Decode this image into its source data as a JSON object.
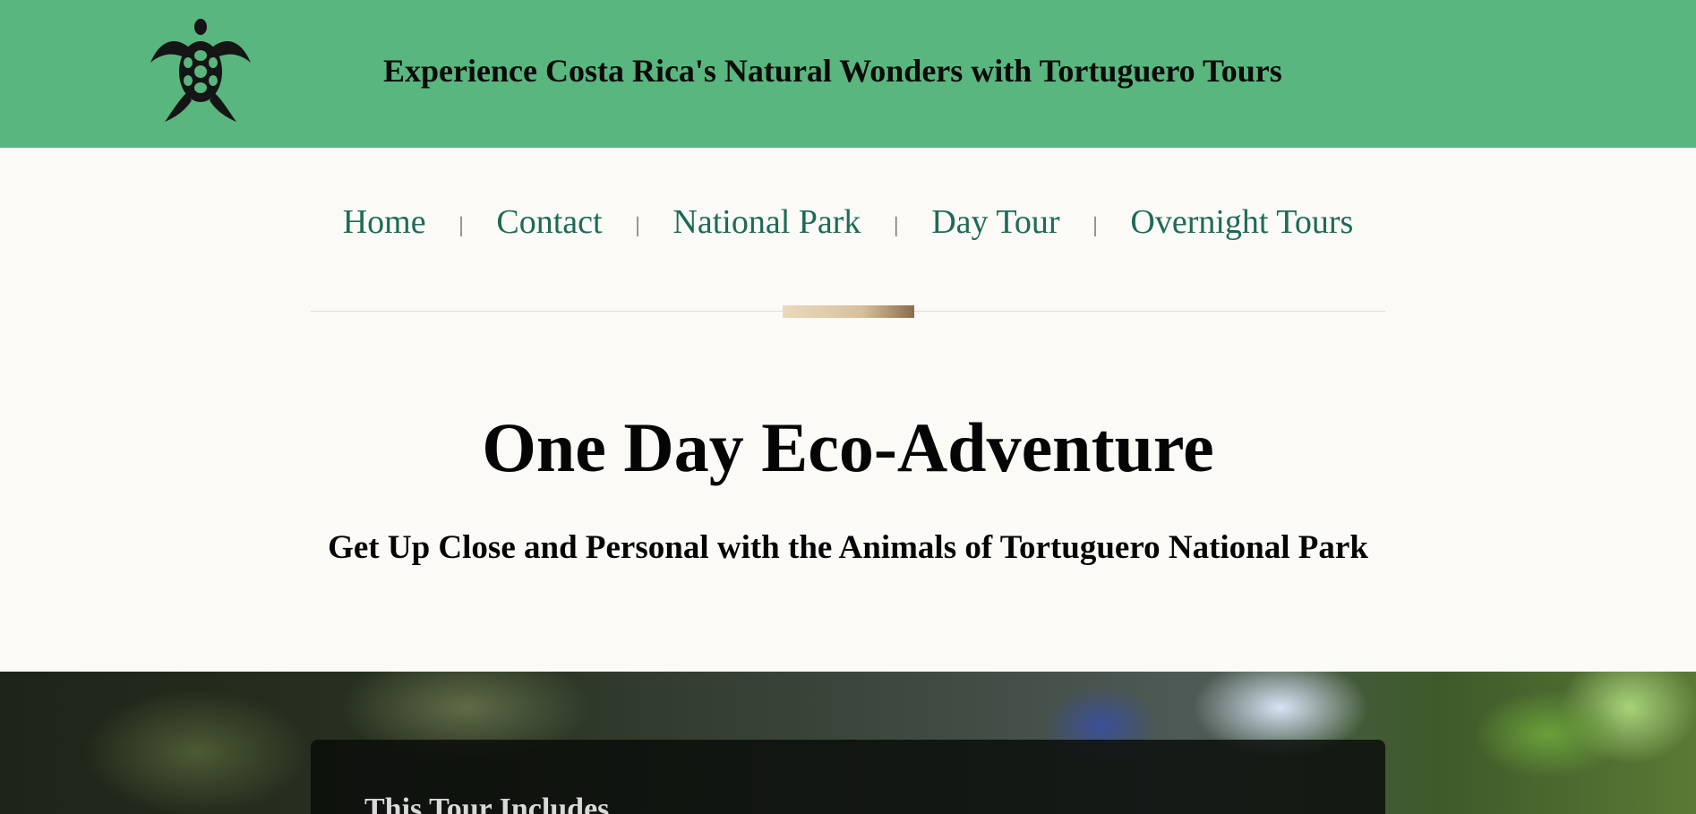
{
  "header": {
    "logo_icon": "sea-turtle-icon",
    "site_title": "Experience Costa Rica's Natural Wonders with Tortuguero Tours",
    "background_color": "#59b67e"
  },
  "nav": {
    "items": [
      {
        "label": "Home"
      },
      {
        "label": "Contact"
      },
      {
        "label": "National Park"
      },
      {
        "label": "Day Tour"
      },
      {
        "label": "Overnight Tours"
      }
    ],
    "separator": "|",
    "link_color": "#1d6b56"
  },
  "hero": {
    "title": "One Day Eco-Adventure",
    "subtitle": "Get Up Close and Personal with the Animals of Tortuguero National Park"
  },
  "includes_section": {
    "title": "This Tour Includes"
  }
}
